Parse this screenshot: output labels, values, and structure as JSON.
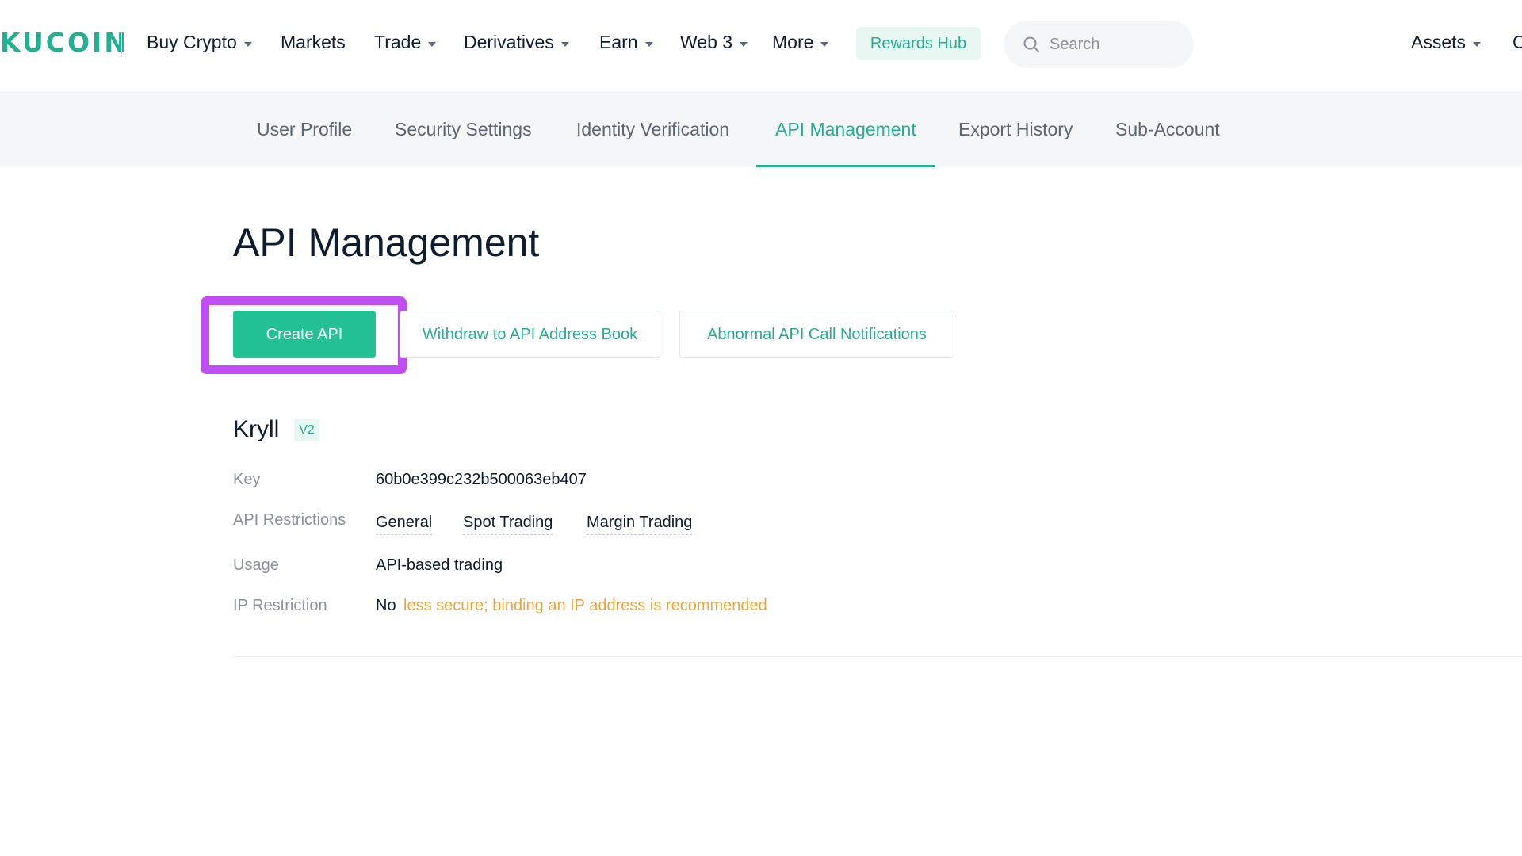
{
  "brand": {
    "logo_text": "KUCOIN",
    "accent_color": "#23af91"
  },
  "topnav": {
    "items": [
      {
        "label": "Buy Crypto",
        "dropdown": true
      },
      {
        "label": "Markets",
        "dropdown": false
      },
      {
        "label": "Trade",
        "dropdown": true
      },
      {
        "label": "Derivatives",
        "dropdown": true
      },
      {
        "label": "Earn",
        "dropdown": true
      },
      {
        "label": "Web 3",
        "dropdown": true
      },
      {
        "label": "More",
        "dropdown": true
      }
    ],
    "rewards_label": "Rewards Hub",
    "search_placeholder": "Search",
    "assets_label": "Assets",
    "edge_glyph": "C"
  },
  "subnav": {
    "tabs": [
      {
        "label": "User Profile",
        "active": false
      },
      {
        "label": "Security Settings",
        "active": false
      },
      {
        "label": "Identity Verification",
        "active": false
      },
      {
        "label": "API Management",
        "active": true
      },
      {
        "label": "Export History",
        "active": false
      },
      {
        "label": "Sub-Account",
        "active": false
      }
    ]
  },
  "main": {
    "title": "API Management",
    "buttons": {
      "create": "Create API",
      "withdraw_book": "Withdraw to API Address Book",
      "abnormal_notifications": "Abnormal API Call Notifications"
    },
    "api_entry": {
      "name": "Kryll",
      "version": "V2",
      "key_label": "Key",
      "key_value": "60b0e399c232b500063eb407",
      "restrictions_label": "API Restrictions",
      "restrictions": [
        "General",
        "Spot Trading",
        "Margin Trading"
      ],
      "usage_label": "Usage",
      "usage_value": "API-based trading",
      "ip_label": "IP Restriction",
      "ip_value": "No",
      "ip_warning": "less secure; binding an IP address is recommended",
      "warning_color": "#f0a43a"
    },
    "highlight_color": "#c14ef2"
  }
}
